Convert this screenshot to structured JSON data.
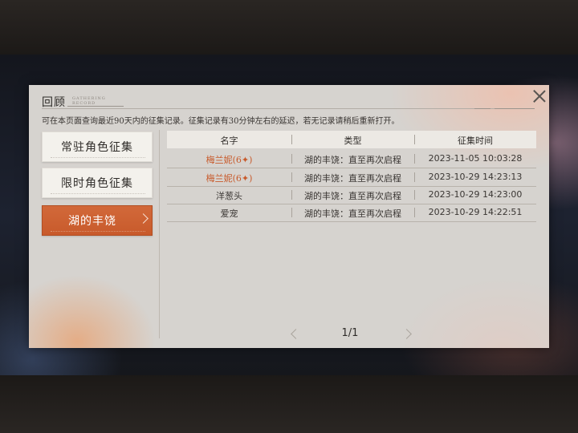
{
  "dialog": {
    "title": "回顾",
    "title_decor": "GATHERING RECORD",
    "notice": "可在本页面查询最近90天内的征集记录。征集记录有30分钟左右的延迟，若无记录请稍后重新打开。"
  },
  "tabs": [
    {
      "label": "常驻角色征集",
      "active": false
    },
    {
      "label": "限时角色征集",
      "active": false
    },
    {
      "label": "湖的丰饶",
      "active": true
    }
  ],
  "table": {
    "headers": [
      "名字",
      "类型",
      "征集时间"
    ],
    "rows": [
      {
        "name": "梅兰妮(6✦)",
        "type": "湖的丰饶：直至再次启程",
        "time": "2023-11-05 10:03:28",
        "highlight": true
      },
      {
        "name": "梅兰妮(6✦)",
        "type": "湖的丰饶：直至再次启程",
        "time": "2023-10-29 14:23:13",
        "highlight": true
      },
      {
        "name": "洋葱头",
        "type": "湖的丰饶：直至再次启程",
        "time": "2023-10-29 14:23:00",
        "highlight": false
      },
      {
        "name": "爱宠",
        "type": "湖的丰饶：直至再次启程",
        "time": "2023-10-29 14:22:51",
        "highlight": false
      }
    ]
  },
  "pagination": {
    "text": "1/1"
  },
  "colors": {
    "accent": "#c85a2b",
    "panel": "#d6d3cf"
  }
}
